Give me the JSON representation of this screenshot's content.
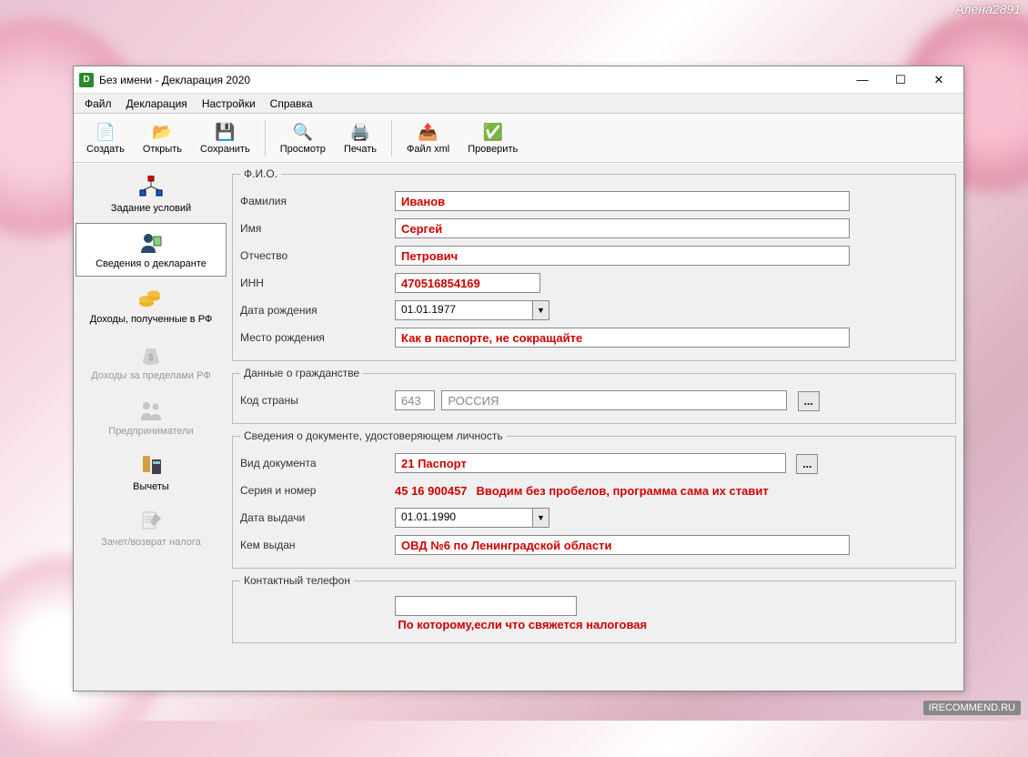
{
  "watermark_top": "Алена2891",
  "watermark_bottom": "IRECOMMEND.RU",
  "window": {
    "title": "Без имени - Декларация 2020",
    "menu": [
      "Файл",
      "Декларация",
      "Настройки",
      "Справка"
    ],
    "toolbar_groups": [
      [
        "Создать",
        "Открыть",
        "Сохранить"
      ],
      [
        "Просмотр",
        "Печать"
      ],
      [
        "Файл xml",
        "Проверить"
      ]
    ]
  },
  "sidebar": {
    "items": [
      {
        "label": "Задание условий"
      },
      {
        "label": "Сведения о декларанте"
      },
      {
        "label": "Доходы, полученные в РФ"
      },
      {
        "label": "Доходы за пределами РФ"
      },
      {
        "label": "Предприниматели"
      },
      {
        "label": "Вычеты"
      },
      {
        "label": "Зачет/возврат налога"
      }
    ],
    "active_index": 1
  },
  "form": {
    "fio": {
      "legend": "Ф.И.О.",
      "surname_label": "Фамилия",
      "surname": "Иванов",
      "name_label": "Имя",
      "name": "Сергей",
      "patronymic_label": "Отчество",
      "patronymic": "Петрович",
      "inn_label": "ИНН",
      "inn": "470516854169",
      "dob_label": "Дата рождения",
      "dob": "01.01.1977",
      "birthplace_label": "Место рождения",
      "birthplace": "Как в паспорте, не сокращайте"
    },
    "citizenship": {
      "legend": "Данные о гражданстве",
      "country_code_label": "Код страны",
      "country_code": "643",
      "country_name": "РОССИЯ"
    },
    "document": {
      "legend": "Сведения о документе, удостоверяющем личность",
      "type_label": "Вид документа",
      "type": "21 Паспорт",
      "series_label": "Серия и номер",
      "series": "45 16 900457",
      "series_note": "Вводим без пробелов, программа сама их ставит",
      "issue_date_label": "Дата выдачи",
      "issue_date": "01.01.1990",
      "issued_by_label": "Кем выдан",
      "issued_by": "ОВД №6 по Ленинградской области"
    },
    "contact": {
      "legend": "Контактный телефон",
      "note": "По которому,если что свяжется налоговая"
    }
  }
}
